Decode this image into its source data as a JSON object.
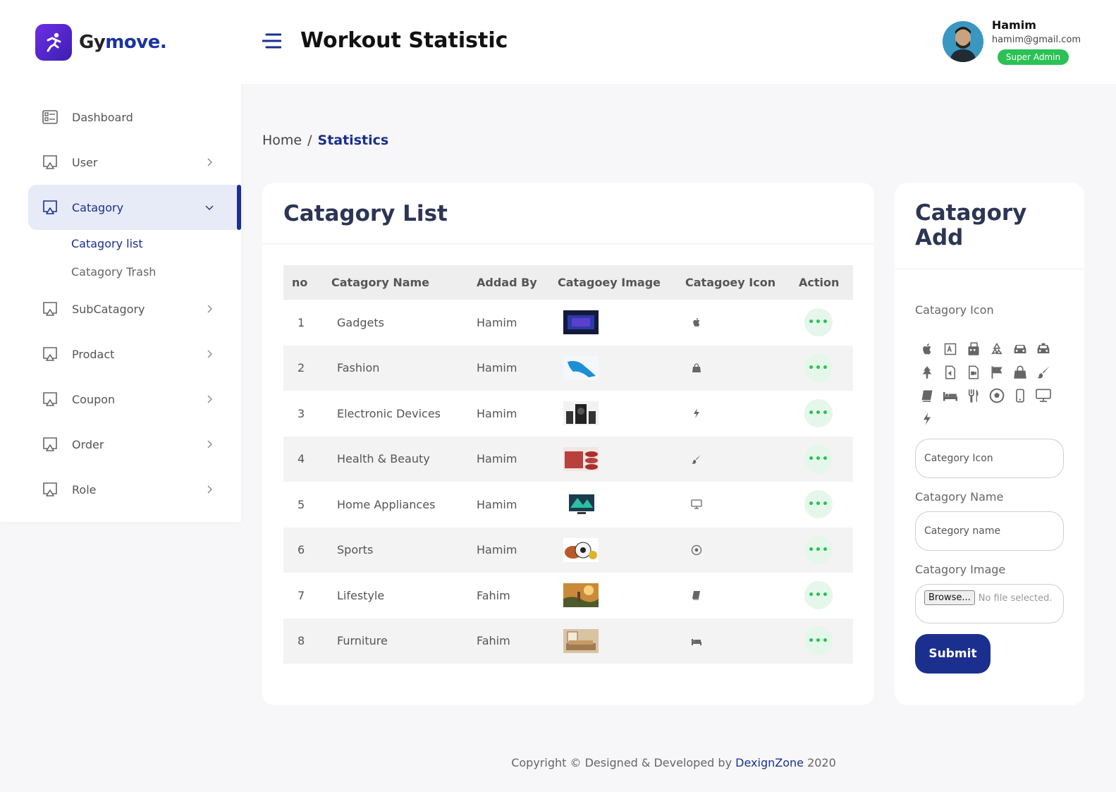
{
  "brand": {
    "part1": "Gy",
    "part2": "move."
  },
  "header": {
    "title": "Workout Statistic",
    "user_name": "Hamim",
    "user_email": "hamim@gmail.com",
    "user_role": "Super Admin"
  },
  "sidebar": {
    "items": [
      {
        "label": "Dashboard",
        "icon": "dashboard-icon"
      },
      {
        "label": "User",
        "icon": "monitor-icon"
      },
      {
        "label": "Catagory",
        "icon": "monitor-icon"
      },
      {
        "label": "SubCatagory",
        "icon": "monitor-icon"
      },
      {
        "label": "Prodact",
        "icon": "monitor-icon"
      },
      {
        "label": "Coupon",
        "icon": "monitor-icon"
      },
      {
        "label": "Order",
        "icon": "monitor-icon"
      },
      {
        "label": "Role",
        "icon": "monitor-icon"
      }
    ],
    "sub": [
      "Catagory list",
      "Catagory Trash"
    ]
  },
  "breadcrumb": {
    "home": "Home",
    "sep": "/",
    "current": "Statistics"
  },
  "list": {
    "title": "Catagory List",
    "headers": [
      "no",
      "Catagory Name",
      "Addad By",
      "Catagoey Image",
      "Catagoey Icon",
      "Action"
    ],
    "rows": [
      {
        "no": "1",
        "name": "Gadgets",
        "by": "Hamim",
        "icon": "apple-icon",
        "action": "•••"
      },
      {
        "no": "2",
        "name": "Fashion",
        "by": "Hamim",
        "icon": "shopping-bag-icon",
        "action": "•••"
      },
      {
        "no": "3",
        "name": "Electronic Devices",
        "by": "Hamim",
        "icon": "bolt-icon",
        "action": "•••"
      },
      {
        "no": "4",
        "name": "Health & Beauty",
        "by": "Hamim",
        "icon": "paint-brush-icon",
        "action": "•••"
      },
      {
        "no": "5",
        "name": "Home Appliances",
        "by": "Hamim",
        "icon": "desktop-icon",
        "action": "•••"
      },
      {
        "no": "6",
        "name": "Sports",
        "by": "Hamim",
        "icon": "soccer-ball-icon",
        "action": "•••"
      },
      {
        "no": "7",
        "name": "Lifestyle",
        "by": "Fahim",
        "icon": "book-icon",
        "action": "•••"
      },
      {
        "no": "8",
        "name": "Furniture",
        "by": "Fahim",
        "icon": "bed-icon",
        "action": "•••"
      }
    ]
  },
  "add": {
    "title_line1": "Catagory",
    "title_line2": "Add",
    "icon_label": "Catagory Icon",
    "icon_placeholder": "Category Icon",
    "name_label": "Catagory Name",
    "name_placeholder": "Category name",
    "image_label": "Catagory Image",
    "browse": "Browse...",
    "no_file": "No file selected.",
    "submit": "Submit"
  },
  "footer": {
    "text": "Copyright © Designed & Developed by",
    "brand": "DexignZone",
    "year": "2020"
  },
  "colors": {
    "primary": "#1b2f8f",
    "success": "#2bc155",
    "accent": "#6d2ee8"
  }
}
